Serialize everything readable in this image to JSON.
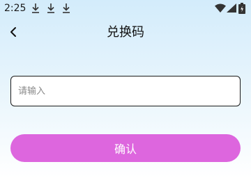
{
  "status_bar": {
    "time": "2:25",
    "icons": [
      "download-icon",
      "download-icon",
      "download-icon",
      "wifi-icon",
      "signal-icon",
      "battery-icon"
    ]
  },
  "header": {
    "title": "兑换码",
    "back_icon": "chevron-left-icon"
  },
  "form": {
    "input_placeholder": "请输入",
    "input_value": "",
    "confirm_label": "确认"
  },
  "colors": {
    "background_top": "#d3ecfb",
    "background_bottom": "#ffffff",
    "confirm_button": "#dd66de",
    "input_border": "#1a1a1a"
  }
}
